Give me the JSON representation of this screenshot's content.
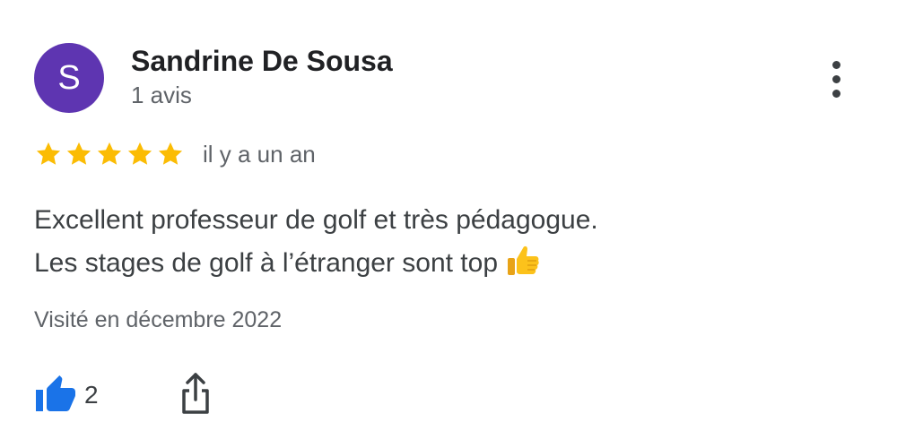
{
  "review": {
    "author": {
      "initial": "S",
      "name": "Sandrine De Sousa",
      "meta": "1 avis",
      "avatar_color": "#5e35b1"
    },
    "rating": {
      "stars": 5,
      "max": 5,
      "color": "#fbbc04",
      "date": "il y a un an"
    },
    "text_lines": [
      "Excellent professeur de golf et très pédagogue.",
      "Les stages de golf à l’étranger sont top"
    ],
    "emoji": "thumbs-up-emoji",
    "visited": "Visité en décembre 2022",
    "actions": {
      "like_count": "2",
      "like_icon": "thumbs-up-icon",
      "like_color": "#1a73e8",
      "share_icon": "share-icon",
      "more_icon": "more-vertical-icon"
    }
  }
}
